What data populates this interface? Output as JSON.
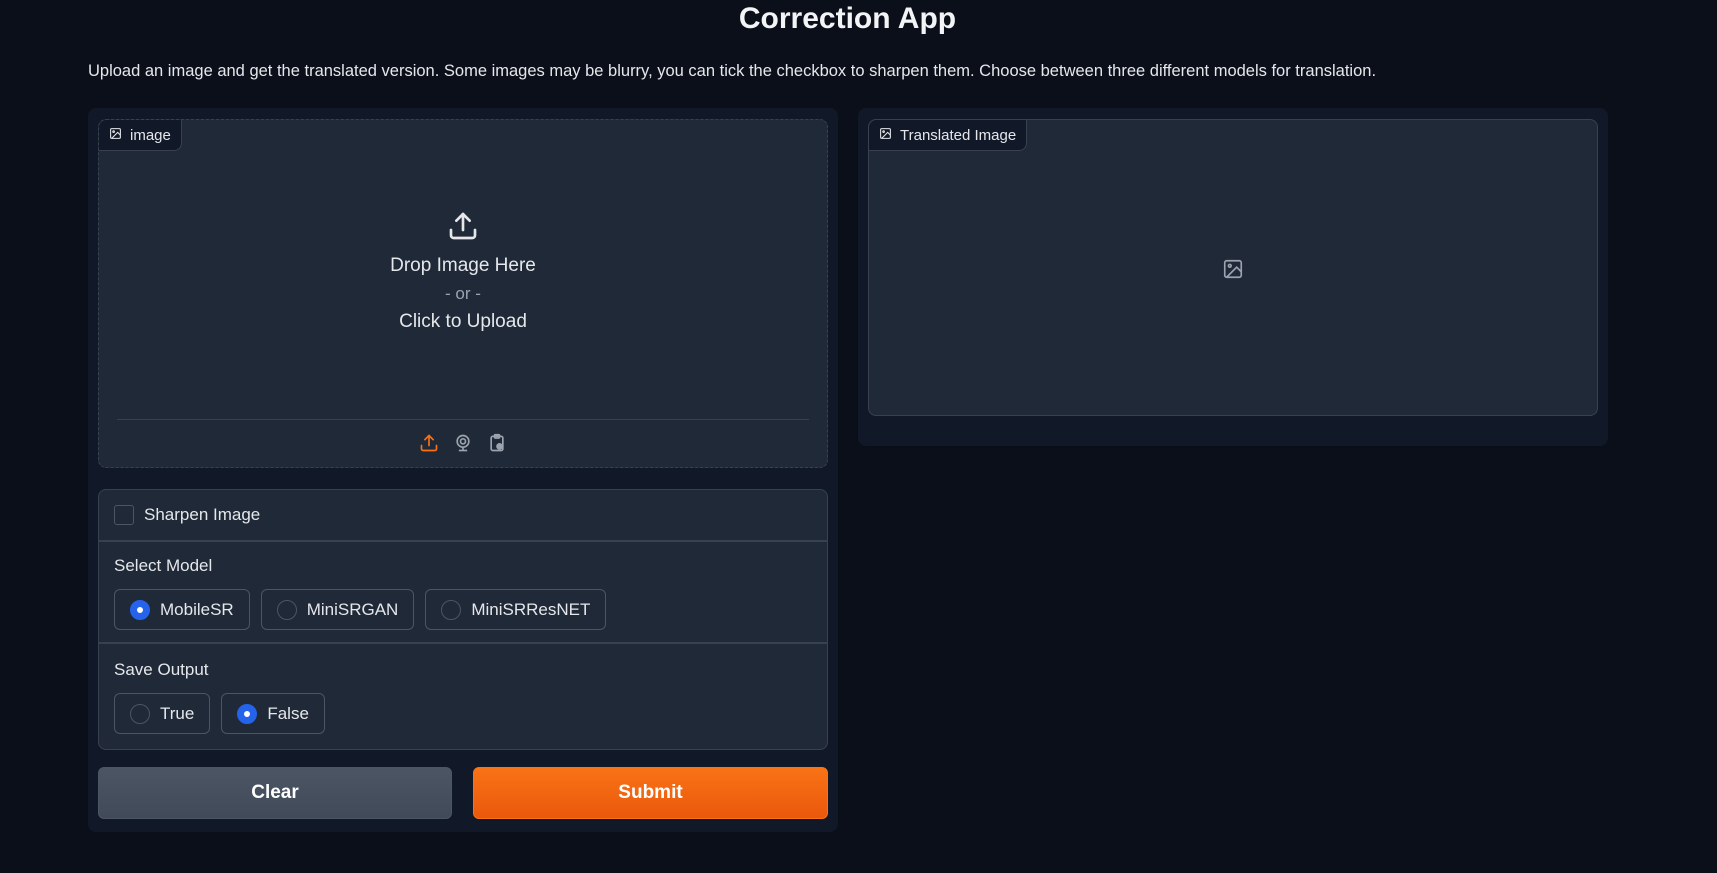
{
  "app": {
    "title": "Correction App",
    "description": "Upload an image and get the translated version. Some images may be blurry, you can tick the checkbox to sharpen them. Choose between three different models for translation."
  },
  "input_image": {
    "label": "image",
    "drop_text": "Drop Image Here",
    "or_text": "- or -",
    "click_text": "Click to Upload",
    "sources": [
      "upload-icon",
      "webcam-icon",
      "clipboard-icon"
    ]
  },
  "output_image": {
    "label": "Translated Image"
  },
  "options": {
    "sharpen_label": "Sharpen Image",
    "sharpen_checked": false,
    "model": {
      "title": "Select Model",
      "choices": [
        "MobileSR",
        "MiniSRGAN",
        "MiniSRResNET"
      ],
      "selected": "MobileSR"
    },
    "save_output": {
      "title": "Save Output",
      "choices": [
        "True",
        "False"
      ],
      "selected": "False"
    }
  },
  "buttons": {
    "clear_label": "Clear",
    "submit_label": "Submit"
  },
  "colors": {
    "background": "#0b0f19",
    "accent": "#f97316",
    "radio_selected": "#2563eb"
  }
}
